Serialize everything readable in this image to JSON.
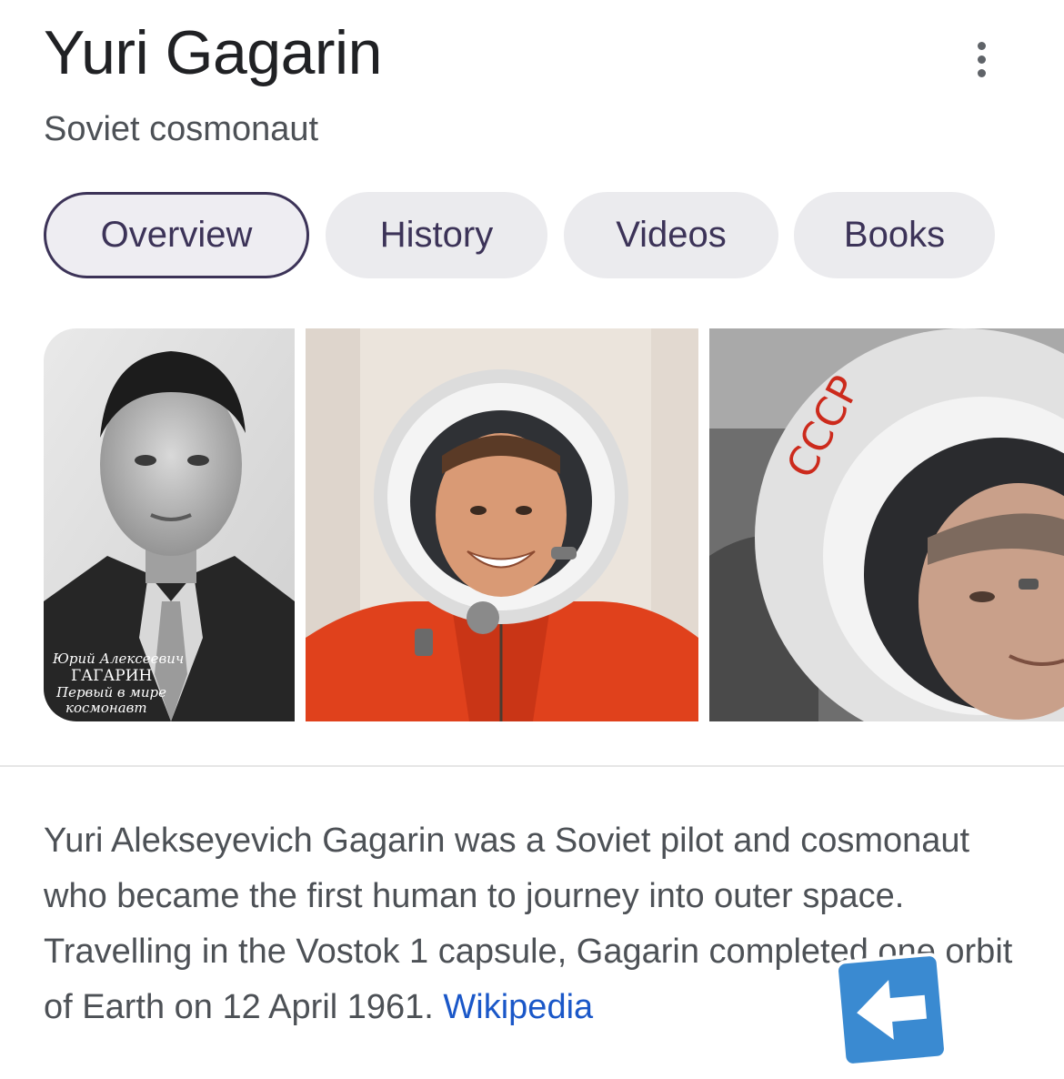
{
  "header": {
    "title": "Yuri Gagarin",
    "subtitle": "Soviet cosmonaut",
    "more_icon": "more-vert-icon"
  },
  "tabs": [
    {
      "label": "Overview",
      "active": true
    },
    {
      "label": "History",
      "active": false
    },
    {
      "label": "Videos",
      "active": false
    },
    {
      "label": "Books",
      "active": false
    }
  ],
  "images": {
    "photo1_caption": [
      "Юрий Алексеевич",
      "ГАГАРИН",
      "Первый в мире",
      "космонавт"
    ],
    "photo3_helmet_text": "СССР"
  },
  "description": {
    "text": "Yuri Alekseyevich Gagarin was a Soviet pilot and cosmonaut who became the first human to journey into outer space. Travelling in the Vostok 1 capsule, Gagarin completed one orbit of Earth on 12 April 1961. ",
    "source_link": "Wikipedia"
  },
  "overlay": {
    "icon": "left-arrow-icon",
    "color": "#3a8ad1"
  },
  "colors": {
    "tab_text": "#3c3358",
    "tab_bg": "#ebebee",
    "link": "#1a57c8",
    "body_text": "#4d5156"
  }
}
